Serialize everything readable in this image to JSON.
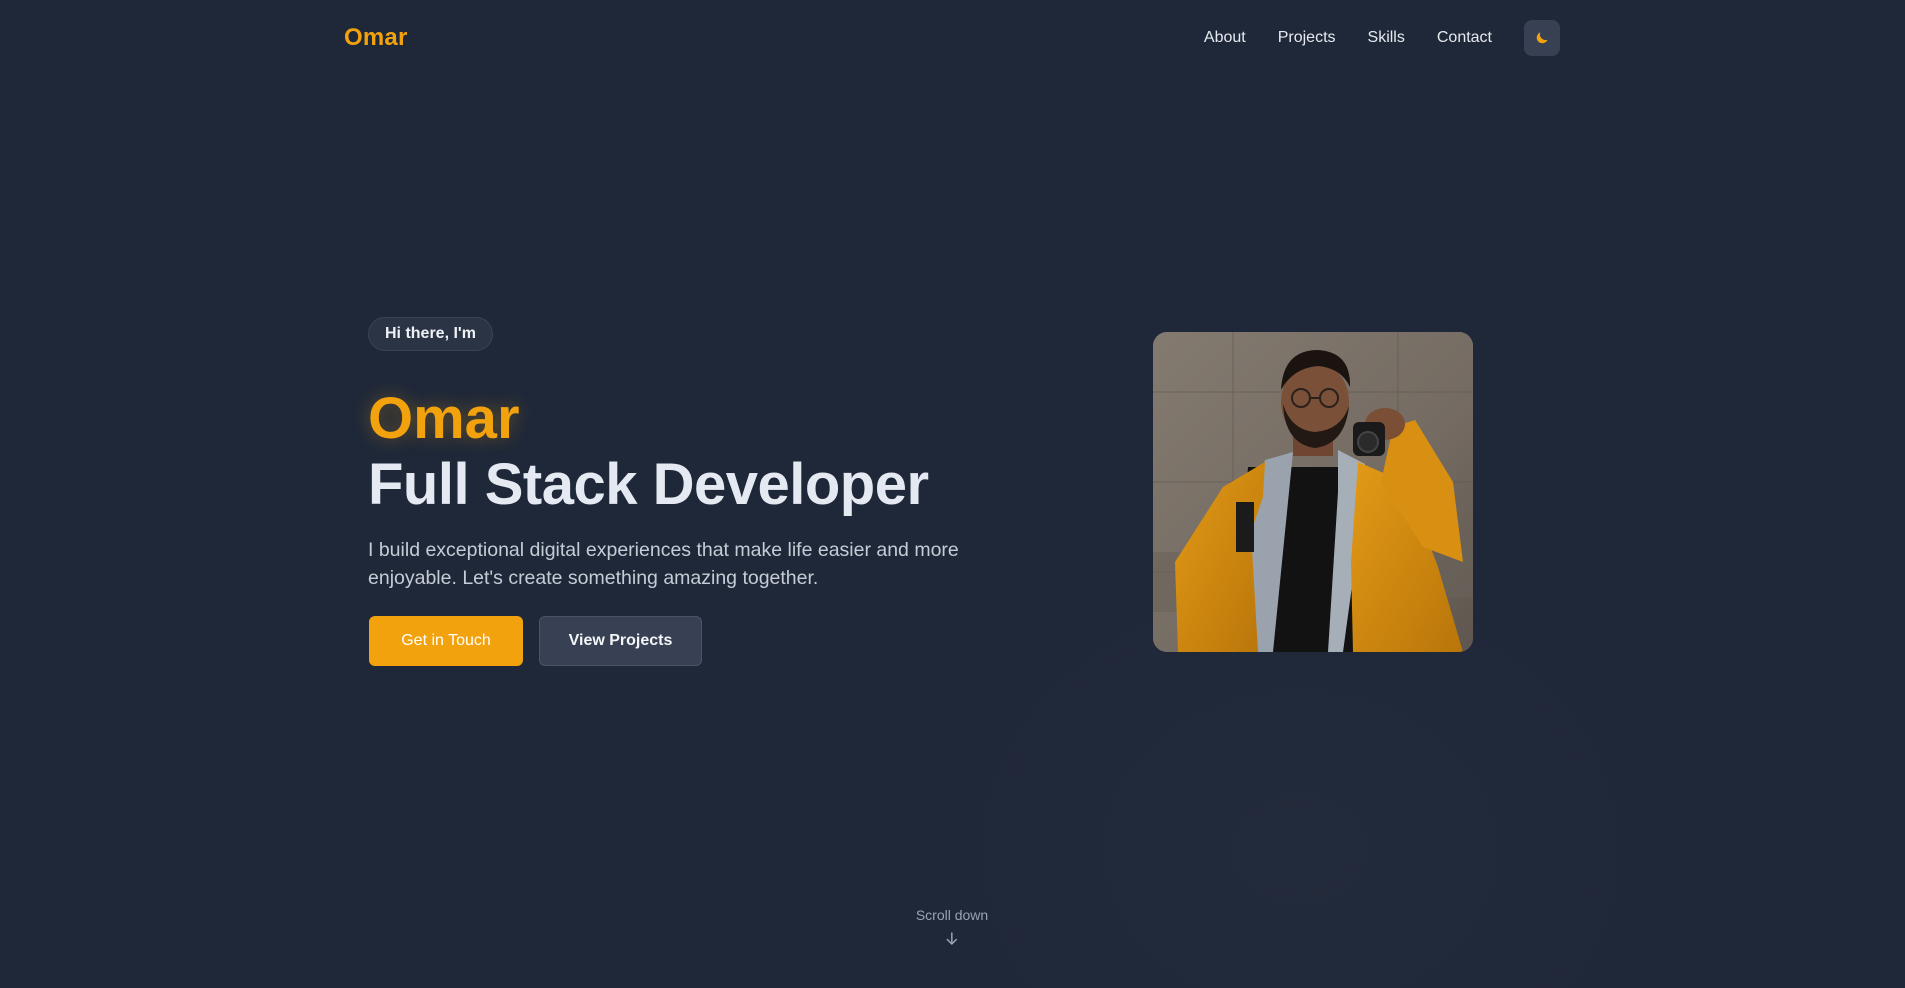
{
  "header": {
    "brand": "Omar",
    "nav": [
      {
        "label": "About"
      },
      {
        "label": "Projects"
      },
      {
        "label": "Skills"
      },
      {
        "label": "Contact"
      }
    ],
    "theme_icon": "moon-icon"
  },
  "hero": {
    "greeting": "Hi there, I'm",
    "name": "Omar",
    "role": "Full Stack Developer",
    "description": "I build exceptional digital experiences that make life easier and more enjoyable. Let's create something amazing together.",
    "primary_button": "Get in Touch",
    "secondary_button": "View Projects",
    "portrait_icon": "profile-photo"
  },
  "scroll": {
    "label": "Scroll down",
    "icon": "arrow-down-icon"
  },
  "colors": {
    "background": "#1f2839",
    "accent": "#f2a20d",
    "heading": "#e5eaf2",
    "muted": "#9aa3b2",
    "secondary_button": "#374153"
  }
}
